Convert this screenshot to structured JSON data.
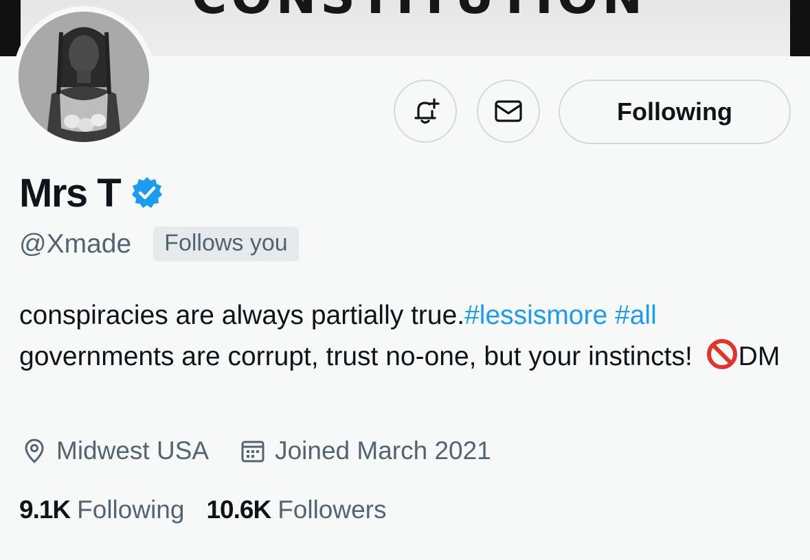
{
  "banner": {
    "text": "CONSTITUTION"
  },
  "profile": {
    "display_name": "Mrs T",
    "handle": "@Xmade",
    "follows_you": "Follows you",
    "verified": true
  },
  "actions": {
    "notify_icon": "bell-plus-icon",
    "message_icon": "envelope-icon",
    "following_label": "Following"
  },
  "bio": {
    "text_1": "conspiracies are always partially true.",
    "hashtag_1": "#lessismore",
    "hashtag_2": "#all",
    "text_2": "governments are corrupt, trust no-one, but your instincts!",
    "emoji": "prohibited-icon",
    "text_3": "DM"
  },
  "meta": {
    "location": "Midwest USA",
    "joined": "Joined March 2021"
  },
  "stats": {
    "following_count": "9.1K",
    "following_label": "Following",
    "followers_count": "10.6K",
    "followers_label": "Followers"
  },
  "colors": {
    "background": "#f7f8f8",
    "text": "#0f1419",
    "secondary": "#536471",
    "accent": "#1d9bf0",
    "border": "#cfd9de"
  }
}
